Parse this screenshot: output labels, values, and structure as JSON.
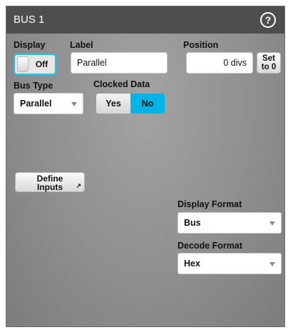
{
  "window": {
    "title": "BUS 1"
  },
  "display": {
    "label": "Display",
    "state": "Off"
  },
  "label_field": {
    "label": "Label",
    "value": "Parallel"
  },
  "position": {
    "label": "Position",
    "value": "0 divs",
    "set_button": "Set\nto 0"
  },
  "bus_type": {
    "label": "Bus Type",
    "value": "Parallel"
  },
  "clocked_data": {
    "label": "Clocked Data",
    "options": [
      "Yes",
      "No"
    ],
    "selected": "No"
  },
  "define_inputs": {
    "label": "Define\nInputs"
  },
  "display_format": {
    "label": "Display Format",
    "value": "Bus"
  },
  "decode_format": {
    "label": "Decode Format",
    "value": "Hex"
  },
  "icons": {
    "help": "help-icon",
    "external": "external-link-icon"
  },
  "colors": {
    "accent": "#00b4e8",
    "titlebar": "#4e4e4e"
  }
}
